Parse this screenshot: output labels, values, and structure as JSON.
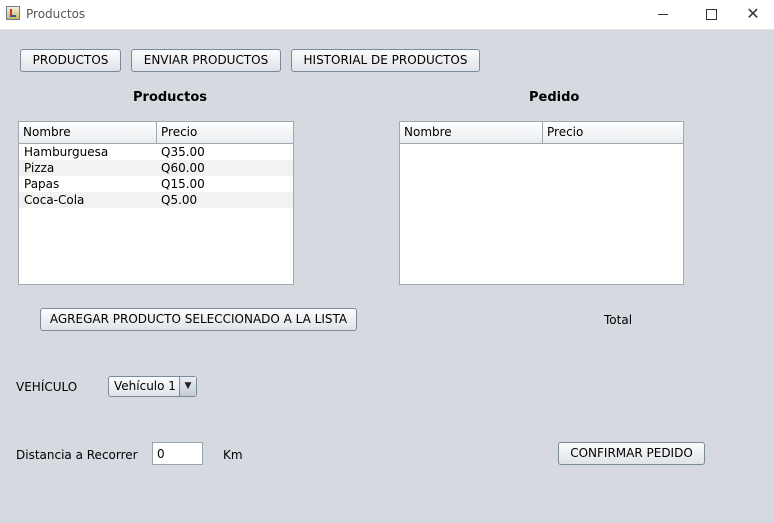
{
  "window": {
    "title": "Productos",
    "minimize_icon": "minimize-icon",
    "maximize_icon": "maximize-icon",
    "close_label": "✕"
  },
  "toolbar": {
    "productos_label": "PRODUCTOS",
    "enviar_label": "ENVIAR PRODUCTOS",
    "historial_label": "HISTORIAL DE PRODUCTOS"
  },
  "productos": {
    "heading": "Productos",
    "columns": [
      "Nombre",
      "Precio"
    ],
    "rows": [
      {
        "nombre": "Hamburguesa",
        "precio": "Q35.00"
      },
      {
        "nombre": "Pizza",
        "precio": "Q60.00"
      },
      {
        "nombre": "Papas",
        "precio": "Q15.00"
      },
      {
        "nombre": "Coca-Cola",
        "precio": "Q5.00"
      }
    ]
  },
  "pedido": {
    "heading": "Pedido",
    "columns": [
      "Nombre",
      "Precio"
    ],
    "rows": [],
    "total_label": "Total"
  },
  "agregar_label": "AGREGAR PRODUCTO SELECCIONADO A LA LISTA",
  "vehiculo": {
    "label": "VEHÍCULO",
    "selected": "Vehículo 1"
  },
  "distancia": {
    "label": "Distancia a Recorrer",
    "value": "0",
    "unit": "Km"
  },
  "confirmar_label": "CONFIRMAR PEDIDO"
}
